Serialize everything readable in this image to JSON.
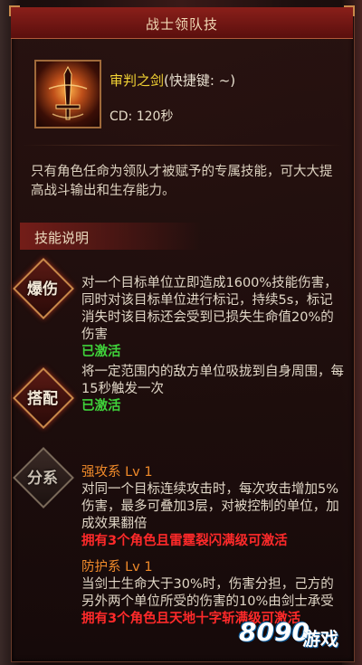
{
  "window": {
    "title": "战士领队技"
  },
  "skill": {
    "name": "审判之剑",
    "shortcut": "(快捷键: ~)",
    "cooldown": "CD: 120秒",
    "description": "只有角色任命为领队才被赋予的专属技能，可大大提高战斗输出和生存能力。"
  },
  "section": {
    "title": "技能说明"
  },
  "entries": [
    {
      "badge": "爆伤",
      "text": "对一个目标单位立即造成1600%技能伤害，同时对该目标单位进行标记，持续5s，标记消失时该目标还会受到已损失生命值20%的伤害",
      "status": "已激活"
    },
    {
      "badge": "搭配",
      "text": "将一定范围内的敌方单位吸拢到自身周围，每15秒触发一次",
      "status": "已激活"
    }
  ],
  "branch": {
    "badge": "分系",
    "items": [
      {
        "title": "强攻系 Lv 1",
        "text": "对同一个目标连续攻击时，每次攻击增加5%伤害，最多可叠加3层，对被控制的单位，加成效果翻倍",
        "requirement": "拥有3个角色且雷霆裂闪满级可激活"
      },
      {
        "title": "防护系 Lv 1",
        "text": "当剑士生命大于30%时，伤害分担，己方的另外两个单位所受的伤害的10%由剑士承受",
        "requirement": "拥有3个角色且天地十字斩满级可激活"
      }
    ]
  },
  "watermark": {
    "number": "8090",
    "text": "游戏"
  },
  "colors": {
    "title_bar": "#7a1a16",
    "skill_name": "#f1d234",
    "active": "#3fd13a",
    "branch_title": "#f08a2a",
    "requirement": "#ff2a2a"
  }
}
